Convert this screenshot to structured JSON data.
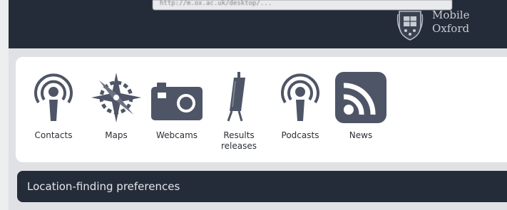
{
  "browser": {
    "url_tooltip": "http://m.ox.ac.uk/desktop/..."
  },
  "header": {
    "logo_line1": "Mobile",
    "logo_line2": "Oxford",
    "crest_icon": "oxford-crest-icon",
    "background": "#252c39"
  },
  "apps": [
    {
      "label": "Contacts",
      "icon": "broadcast-person-icon"
    },
    {
      "label": "Maps",
      "icon": "compass-star-icon"
    },
    {
      "label": "Webcams",
      "icon": "camera-icon"
    },
    {
      "label": "Results\nreleases",
      "icon": "easel-icon"
    },
    {
      "label": "Podcasts",
      "icon": "broadcast-person-icon"
    },
    {
      "label": "News",
      "icon": "rss-icon"
    }
  ],
  "location_section": {
    "label": "Location-finding preferences"
  },
  "colors": {
    "icon": "#4e5566",
    "panel": "#ffffff",
    "page": "#dfe1e4"
  }
}
